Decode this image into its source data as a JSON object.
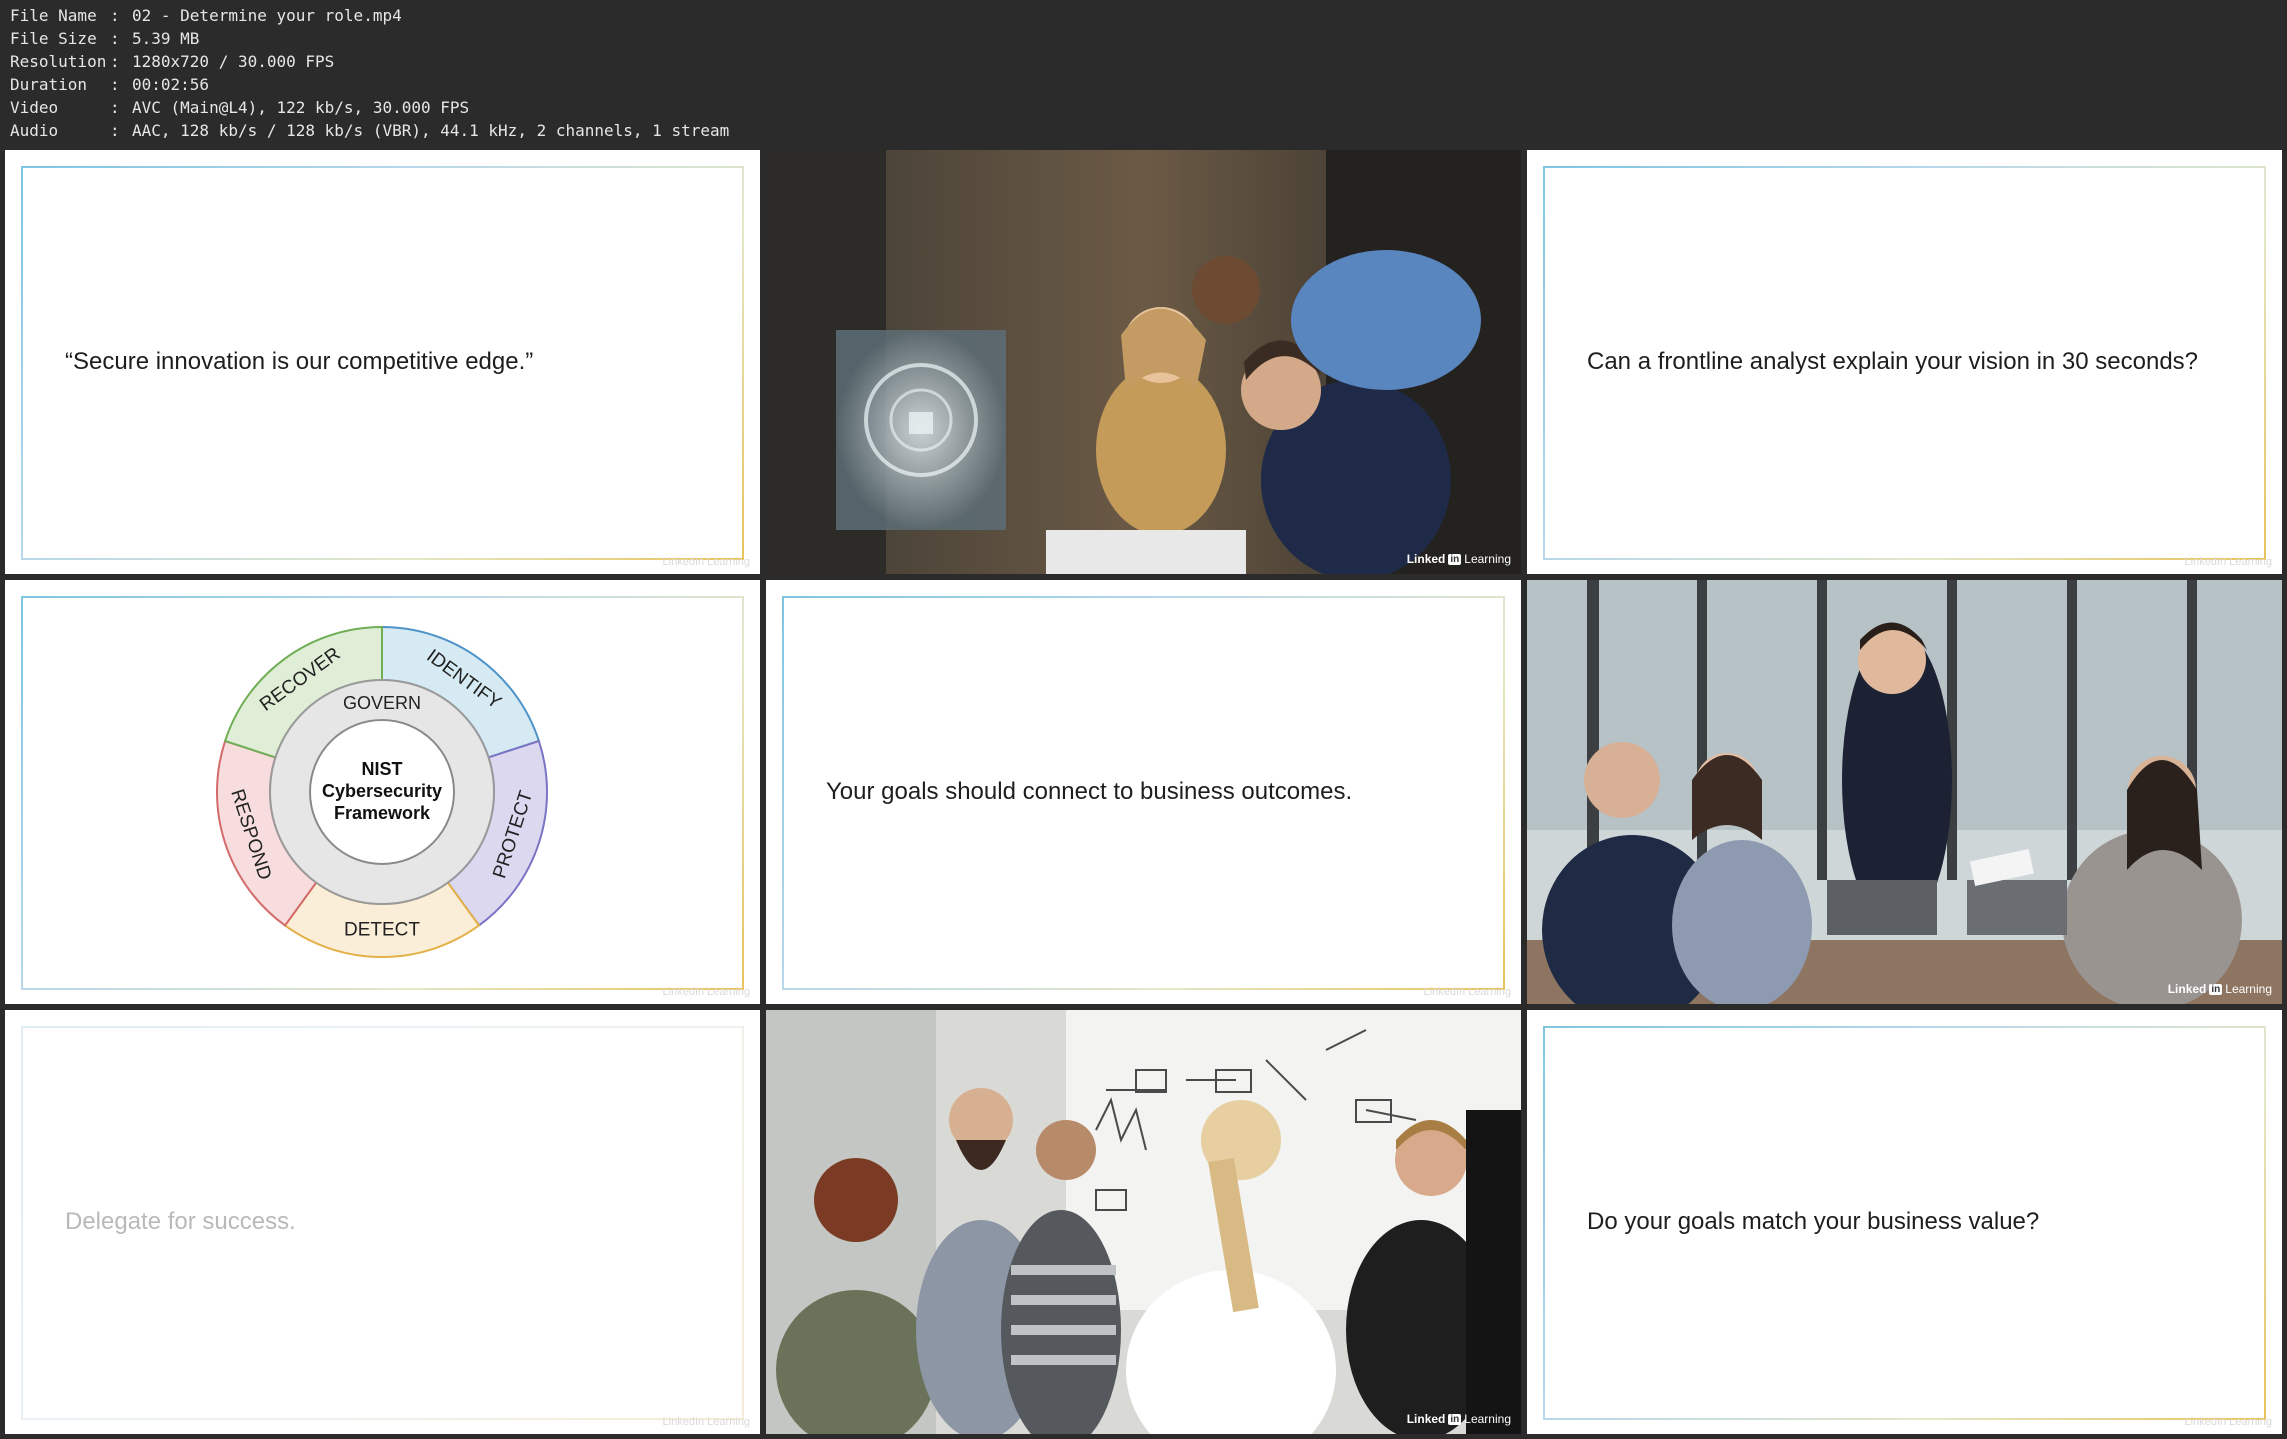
{
  "file_info": [
    {
      "key": "File Name",
      "value": "02 - Determine your role.mp4"
    },
    {
      "key": "File Size",
      "value": "5.39 MB"
    },
    {
      "key": "Resolution",
      "value": "1280x720 / 30.000 FPS"
    },
    {
      "key": "Duration",
      "value": "00:02:56"
    },
    {
      "key": "Video",
      "value": "AVC (Main@L4), 122 kb/s, 30.000 FPS"
    },
    {
      "key": "Audio",
      "value": "AAC, 128 kb/s / 128 kb/s (VBR), 44.1 kHz, 2 channels, 1 stream"
    }
  ],
  "separator": ":",
  "slides": {
    "s1": "“Secure innovation is our competitive edge.”",
    "s3": "Can a frontline analyst explain your vision in 30 seconds?",
    "s5": "Your goals should connect to business outcomes.",
    "s7": "Delegate for success.",
    "s9": "Do your goals match your business value?"
  },
  "watermark": "LinkedIn Learning",
  "badge": {
    "brand": "Linked",
    "in": "in",
    "product": "Learning"
  },
  "nist": {
    "center": [
      "NIST",
      "Cybersecurity",
      "Framework"
    ],
    "inner": "GOVERN",
    "segments": [
      {
        "label": "IDENTIFY",
        "fill": "#d6eaf3",
        "stroke": "#4f93c8"
      },
      {
        "label": "PROTECT",
        "fill": "#dcd8f0",
        "stroke": "#7a74c4"
      },
      {
        "label": "DETECT",
        "fill": "#fbeed8",
        "stroke": "#e3b148"
      },
      {
        "label": "RESPOND",
        "fill": "#f7dddd",
        "stroke": "#d46a6a"
      },
      {
        "label": "RECOVER",
        "fill": "#e1eed7",
        "stroke": "#6fae55"
      }
    ]
  }
}
